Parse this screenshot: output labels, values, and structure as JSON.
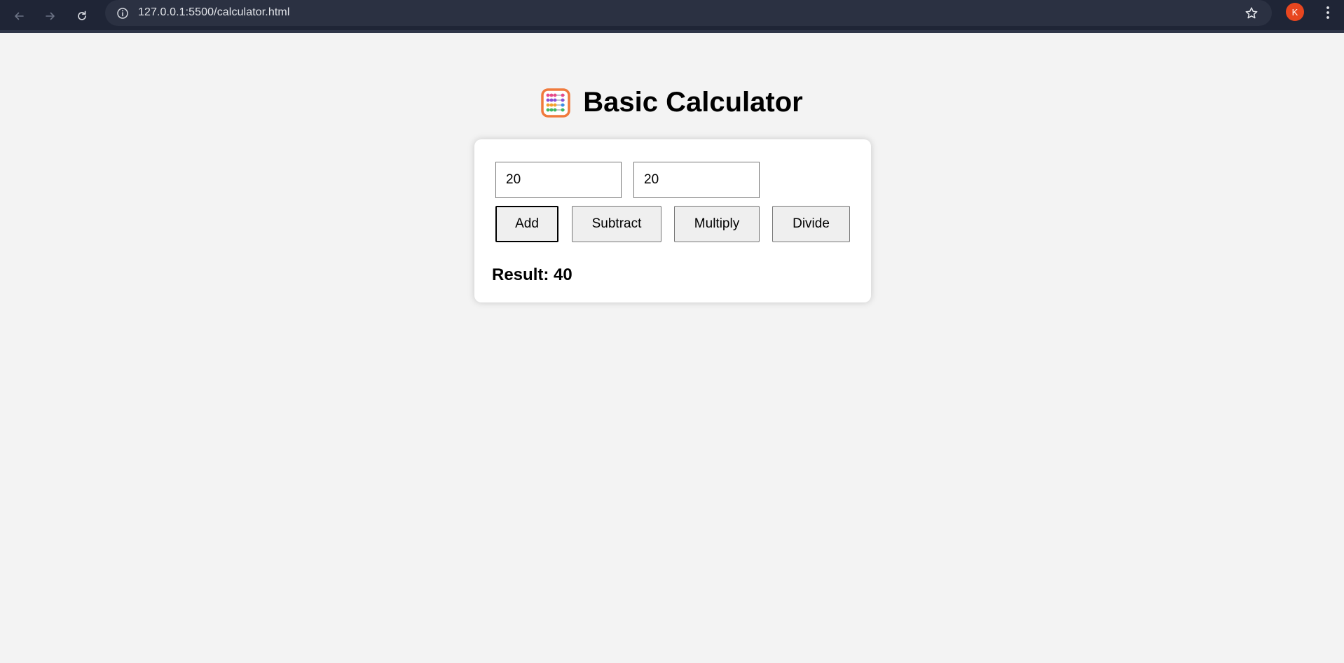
{
  "browser": {
    "url": "127.0.0.1:5500/calculator.html",
    "profile_initial": "K",
    "profile_color": "#e8461f"
  },
  "page": {
    "title": "Basic Calculator",
    "title_icon": "abacus-icon"
  },
  "calculator": {
    "first_number": "20",
    "second_number": "20",
    "buttons": {
      "add": "Add",
      "subtract": "Subtract",
      "multiply": "Multiply",
      "divide": "Divide"
    },
    "result_label": "Result:",
    "result_value": "40",
    "result_text": "Result: 40"
  }
}
